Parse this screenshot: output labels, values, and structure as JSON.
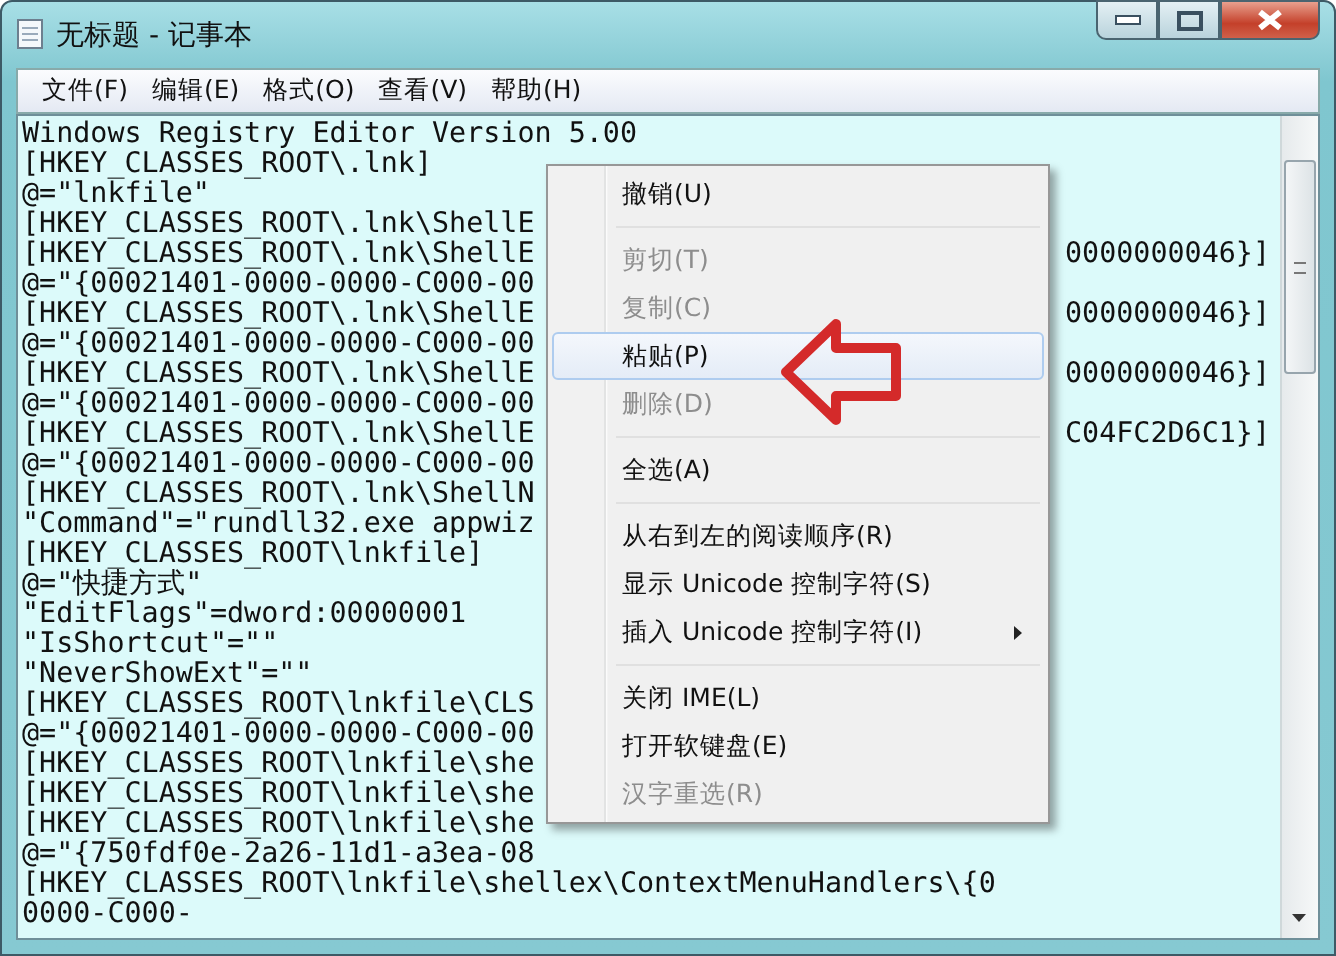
{
  "window": {
    "title": "无标题 - 记事本"
  },
  "menu_bar": [
    "文件(F)",
    "编辑(E)",
    "格式(O)",
    "查看(V)",
    "帮助(H)"
  ],
  "lines": [
    {
      "text": "Windows Registry Editor Version 5.00"
    },
    {
      "text": "[HKEY_CLASSES_ROOT\\.lnk]"
    },
    {
      "text": "@=\"lnkfile\""
    },
    {
      "text": "[HKEY_CLASSES_ROOT\\.lnk\\ShellE"
    },
    {
      "text": "[HKEY_CLASSES_ROOT\\.lnk\\ShellE",
      "tail": "0000000046}]"
    },
    {
      "text": "@=\"{00021401-0000-0000-C000-00"
    },
    {
      "text": "[HKEY_CLASSES_ROOT\\.lnk\\ShellE",
      "tail": "0000000046}]"
    },
    {
      "text": "@=\"{00021401-0000-0000-C000-00"
    },
    {
      "text": "[HKEY_CLASSES_ROOT\\.lnk\\ShellE",
      "tail": "0000000046}]"
    },
    {
      "text": "@=\"{00021401-0000-0000-C000-00"
    },
    {
      "text": "[HKEY_CLASSES_ROOT\\.lnk\\ShellE",
      "tail": "C04FC2D6C1}]"
    },
    {
      "text": "@=\"{00021401-0000-0000-C000-00"
    },
    {
      "text": "[HKEY_CLASSES_ROOT\\.lnk\\ShellN"
    },
    {
      "text": "\"Command\"=\"rundll32.exe appwiz"
    },
    {
      "text": "[HKEY_CLASSES_ROOT\\lnkfile]"
    },
    {
      "text": "@=\"快捷方式\""
    },
    {
      "text": "\"EditFlags\"=dword:00000001"
    },
    {
      "text": "\"IsShortcut\"=\"\""
    },
    {
      "text": "\"NeverShowExt\"=\"\""
    },
    {
      "text": "[HKEY_CLASSES_ROOT\\lnkfile\\CLS"
    },
    {
      "text": "@=\"{00021401-0000-0000-C000-00"
    },
    {
      "text": "[HKEY_CLASSES_ROOT\\lnkfile\\she"
    },
    {
      "text": "[HKEY_CLASSES_ROOT\\lnkfile\\she"
    },
    {
      "text": "[HKEY_CLASSES_ROOT\\lnkfile\\she"
    },
    {
      "text": "@=\"{750fdf0e-2a26-11d1-a3ea-08"
    },
    {
      "text": "[HKEY_CLASSES_ROOT\\lnkfile\\shellex\\ContextMenuHandlers\\{0"
    },
    {
      "text": "0000-C000-"
    }
  ],
  "context_menu": [
    {
      "kind": "item",
      "label": "撤销(U)",
      "disabled": false,
      "selected": false
    },
    {
      "kind": "separator"
    },
    {
      "kind": "item",
      "label": "剪切(T)",
      "disabled": true,
      "selected": false
    },
    {
      "kind": "item",
      "label": "复制(C)",
      "disabled": true,
      "selected": false
    },
    {
      "kind": "item",
      "label": "粘贴(P)",
      "disabled": false,
      "selected": true
    },
    {
      "kind": "item",
      "label": "删除(D)",
      "disabled": true,
      "selected": false
    },
    {
      "kind": "separator"
    },
    {
      "kind": "item",
      "label": "全选(A)",
      "disabled": false,
      "selected": false
    },
    {
      "kind": "separator"
    },
    {
      "kind": "item",
      "label": "从右到左的阅读顺序(R)",
      "disabled": false,
      "selected": false
    },
    {
      "kind": "item",
      "label": "显示 Unicode 控制字符(S)",
      "disabled": false,
      "selected": false
    },
    {
      "kind": "submenu",
      "label": "插入 Unicode 控制字符(I)",
      "disabled": false,
      "selected": false
    },
    {
      "kind": "separator"
    },
    {
      "kind": "item",
      "label": "关闭 IME(L)",
      "disabled": false,
      "selected": false
    },
    {
      "kind": "item",
      "label": "打开软键盘(E)",
      "disabled": false,
      "selected": false
    },
    {
      "kind": "item",
      "label": "汉字重选(R)",
      "disabled": true,
      "selected": false
    }
  ]
}
